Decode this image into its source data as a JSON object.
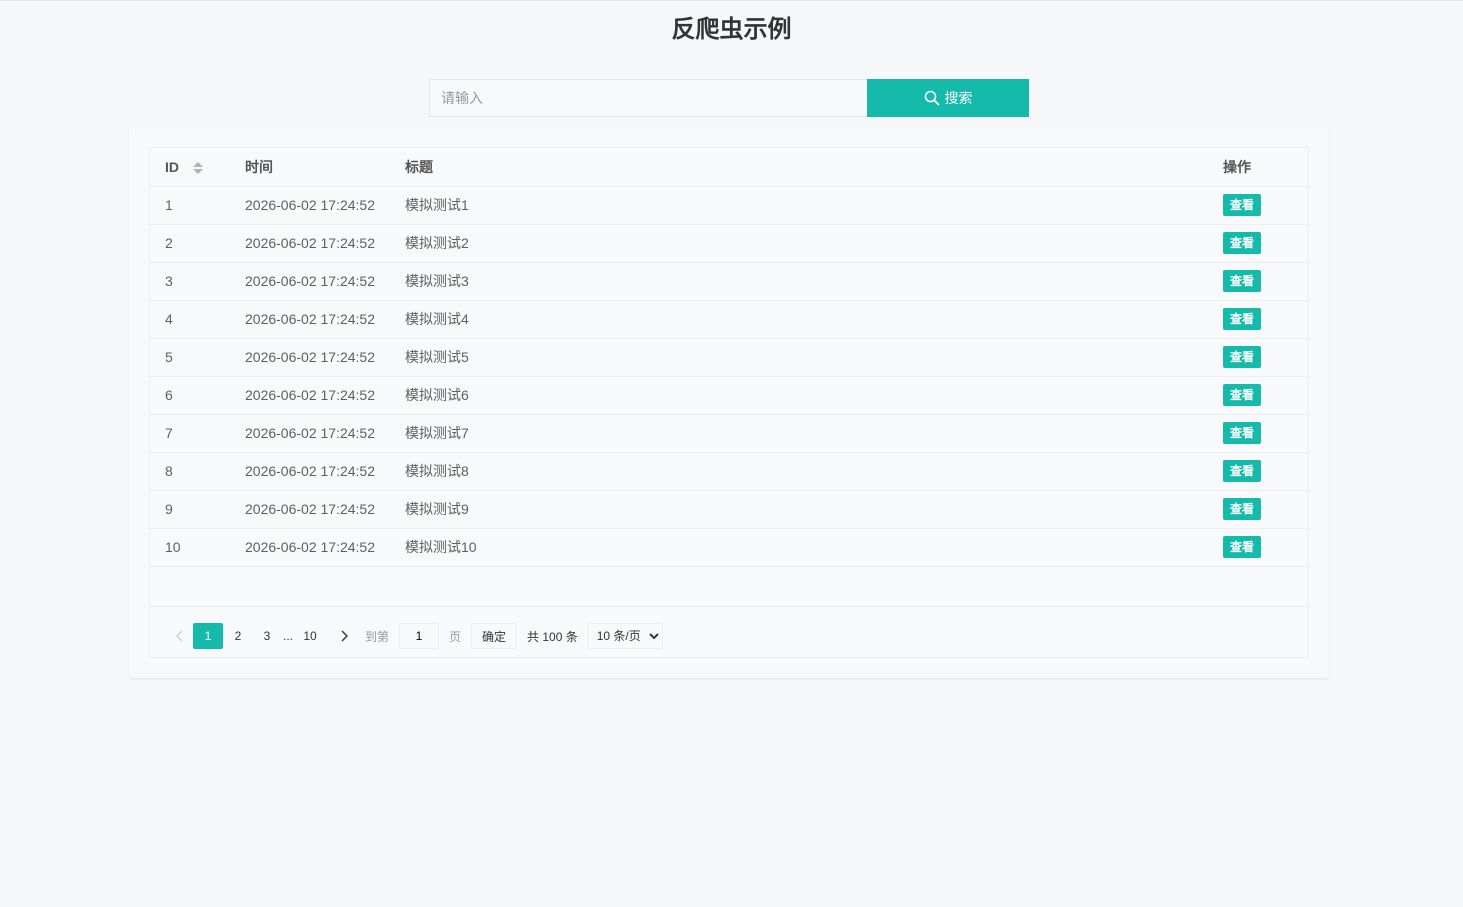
{
  "page_title": "反爬虫示例",
  "search": {
    "placeholder": "请输入",
    "value": "",
    "button_label": "搜索"
  },
  "table": {
    "columns": [
      "ID",
      "时间",
      "标题",
      "操作"
    ],
    "rows": [
      {
        "id": "1",
        "time": "2026-06-02 17:24:52",
        "title": "模拟测试1",
        "action": "查看"
      },
      {
        "id": "2",
        "time": "2026-06-02 17:24:52",
        "title": "模拟测试2",
        "action": "查看"
      },
      {
        "id": "3",
        "time": "2026-06-02 17:24:52",
        "title": "模拟测试3",
        "action": "查看"
      },
      {
        "id": "4",
        "time": "2026-06-02 17:24:52",
        "title": "模拟测试4",
        "action": "查看"
      },
      {
        "id": "5",
        "time": "2026-06-02 17:24:52",
        "title": "模拟测试5",
        "action": "查看"
      },
      {
        "id": "6",
        "time": "2026-06-02 17:24:52",
        "title": "模拟测试6",
        "action": "查看"
      },
      {
        "id": "7",
        "time": "2026-06-02 17:24:52",
        "title": "模拟测试7",
        "action": "查看"
      },
      {
        "id": "8",
        "time": "2026-06-02 17:24:52",
        "title": "模拟测试8",
        "action": "查看"
      },
      {
        "id": "9",
        "time": "2026-06-02 17:24:52",
        "title": "模拟测试9",
        "action": "查看"
      },
      {
        "id": "10",
        "time": "2026-06-02 17:24:52",
        "title": "模拟测试10",
        "action": "查看"
      }
    ]
  },
  "pagination": {
    "pages": [
      "1",
      "2",
      "3"
    ],
    "ellipsis": "...",
    "last_page": "10",
    "current_page": "1",
    "goto_label": "到第",
    "goto_value": "1",
    "page_unit": "页",
    "confirm_label": "确定",
    "total_text": "共 100 条",
    "page_size_options": [
      "10 条/页"
    ],
    "page_size_selected": "10 条/页"
  },
  "colors": {
    "accent": "#16baaa",
    "background": "#f6f7f9"
  },
  "icons": {
    "search": "search-icon",
    "sort": "sort-icon",
    "prev": "chevron-left-icon",
    "next": "chevron-right-icon"
  }
}
